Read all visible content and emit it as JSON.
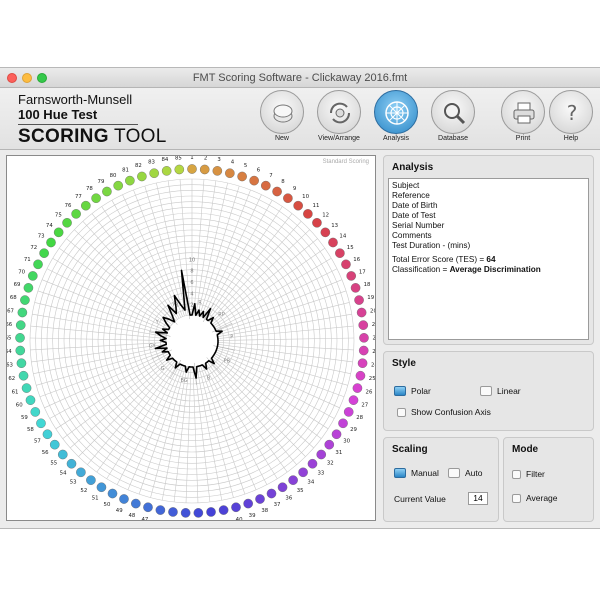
{
  "window": {
    "title": "FMT Scoring Software - Clickaway 2016.fmt"
  },
  "brand": {
    "line1": "Farnsworth-Munsell",
    "line2": "100 Hue Test",
    "line3_bold": "SCORING",
    "line3_thin": " TOOL"
  },
  "toolbar": {
    "buttons": [
      {
        "label": "New",
        "icon": "document-icon"
      },
      {
        "label": "View/Arrange",
        "icon": "arrange-icon"
      },
      {
        "label": "Analysis",
        "icon": "polar-target-icon",
        "active": true
      },
      {
        "label": "Database",
        "icon": "magnifier-icon"
      },
      {
        "label": "Print",
        "icon": "printer-icon"
      },
      {
        "label": "Help",
        "icon": "question-icon"
      }
    ]
  },
  "chart": {
    "mode_label": "Standard Scoring",
    "hue_labels": [
      "1",
      "2",
      "3",
      "4",
      "5",
      "6",
      "7",
      "8",
      "9",
      "10",
      "11",
      "12",
      "13",
      "14",
      "15",
      "16",
      "17",
      "18",
      "19",
      "20",
      "21",
      "22",
      "23",
      "24",
      "25",
      "26",
      "27",
      "28",
      "29",
      "30",
      "31",
      "32",
      "33",
      "34",
      "35",
      "36",
      "37",
      "38",
      "39",
      "40",
      "41",
      "42",
      "43",
      "44",
      "45",
      "46",
      "47",
      "48",
      "49",
      "50",
      "51",
      "52",
      "53",
      "54",
      "55",
      "56",
      "57",
      "58",
      "59",
      "60",
      "61",
      "62",
      "63",
      "64",
      "65",
      "66",
      "67",
      "68",
      "69",
      "70",
      "71",
      "72",
      "73",
      "74",
      "75",
      "76",
      "77",
      "78",
      "79",
      "80",
      "81",
      "82",
      "83",
      "84",
      "85"
    ],
    "ring_scale": [
      "2",
      "4",
      "6",
      "8",
      "10"
    ],
    "sector_labels": [
      "R",
      "YR",
      "Y",
      "GY",
      "G",
      "BG",
      "B",
      "PB",
      "P",
      "RP"
    ]
  },
  "chart_data": {
    "type": "polar",
    "theta_categories": "cap number 1-85",
    "r_min": 2,
    "r_max": 26,
    "series": [
      {
        "values": [
          2,
          4,
          2,
          3,
          2,
          3,
          2,
          4,
          2,
          2,
          3,
          2,
          2,
          2,
          2,
          2,
          2,
          3,
          2,
          2,
          2,
          2,
          2,
          2,
          2,
          2,
          2,
          2,
          2,
          2,
          2,
          2,
          3,
          2,
          2,
          2,
          3,
          2,
          2,
          2,
          2,
          4,
          2,
          2,
          2,
          3,
          2,
          2,
          2,
          2,
          3,
          2,
          2,
          2,
          2,
          3,
          2,
          2,
          2,
          3,
          2,
          4,
          2,
          2,
          3,
          2,
          3,
          4,
          2,
          3,
          2,
          2,
          3,
          4,
          3,
          2,
          3,
          5,
          3,
          4,
          6,
          4,
          3,
          10,
          2
        ]
      }
    ]
  },
  "analysis": {
    "title": "Analysis",
    "lines": [
      "Subject",
      "Reference",
      "Date of Birth",
      "Date of Test",
      "Serial Number",
      "Comments",
      "Test Duration - (mins)"
    ],
    "tes_label": "Total Error Score (TES) = ",
    "tes_value": "64",
    "class_label": "Classification = ",
    "class_value": "Average Discrimination"
  },
  "style": {
    "title": "Style",
    "polar": "Polar",
    "linear": "Linear",
    "confusion": "Show Confusion Axis"
  },
  "scaling": {
    "title": "Scaling",
    "manual": "Manual",
    "auto": "Auto",
    "current_label": "Current Value",
    "current_value": "14"
  },
  "mode": {
    "title": "Mode",
    "filter": "Filter",
    "average": "Average"
  }
}
